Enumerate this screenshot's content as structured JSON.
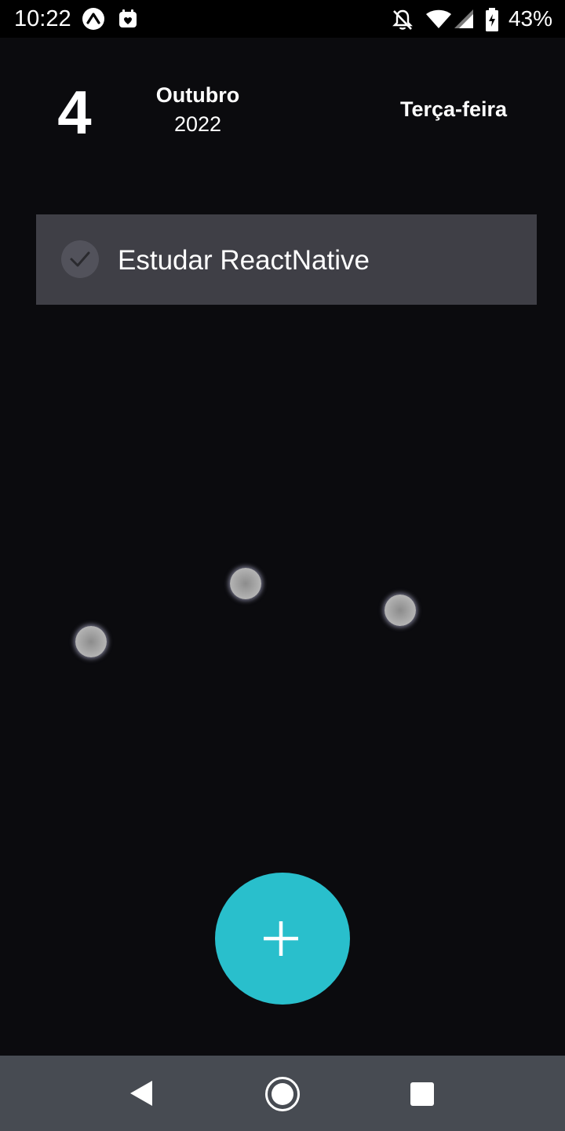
{
  "status_bar": {
    "time": "10:22",
    "battery": "43%",
    "icons": [
      "expo-icon",
      "calendar-heart-icon",
      "notifications-off-icon",
      "wifi-icon",
      "cell-signal-icon",
      "battery-icon"
    ]
  },
  "header": {
    "day": "4",
    "month": "Outubro",
    "year": "2022",
    "weekday": "Terça-feira"
  },
  "tasks": [
    {
      "label": "Estudar ReactNative",
      "done": false
    }
  ],
  "fab": {
    "icon": "plus-icon"
  },
  "nav_bar": {
    "icons": [
      "back-icon",
      "home-icon",
      "recents-icon"
    ]
  },
  "colors": {
    "background": "#0b0b0e",
    "card": "#3f3f46",
    "accent": "#29bfcc",
    "nav": "#474b52"
  }
}
